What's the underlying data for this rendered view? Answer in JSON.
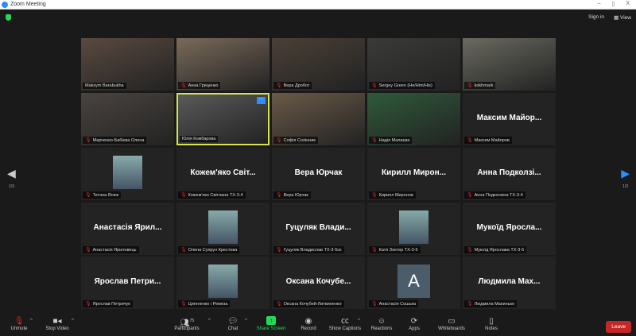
{
  "window": {
    "title": "Zoom Meeting",
    "minimize": "–",
    "restore": "▯",
    "close": "X"
  },
  "topbar": {
    "sign_in": "Sign in",
    "view": "View"
  },
  "page": {
    "left": "1/3",
    "right": "1/3"
  },
  "tiles": [
    {
      "label": "Maksym Barabukha",
      "type": "video",
      "muted": false
    },
    {
      "label": "Анна Гриценко",
      "type": "video",
      "muted": true
    },
    {
      "label": "Вера Дробот",
      "type": "video",
      "muted": true
    },
    {
      "label": "Sergey Green (He/Him/His)",
      "type": "video",
      "muted": true
    },
    {
      "label": "kokhmark",
      "type": "video",
      "muted": true
    },
    {
      "label": "Марченко-Бабієва Олена",
      "type": "video",
      "muted": true
    },
    {
      "label": "Юлія Комбарова",
      "type": "video",
      "muted": false,
      "active": true
    },
    {
      "label": "Софія Солінник",
      "type": "video",
      "muted": true
    },
    {
      "label": "Надія Малиєва",
      "type": "video",
      "muted": true
    },
    {
      "label": "Максим Майоров",
      "big": "Максим  Майор...",
      "type": "name",
      "muted": true
    },
    {
      "label": "Тетяна Янюк",
      "type": "pic",
      "muted": true
    },
    {
      "label": "Кожем'яко Світлана ТХ-3-4",
      "big": "Кожем'яко Світ...",
      "type": "name",
      "muted": true
    },
    {
      "label": "Вера Юрчак",
      "big": "Вера Юрчак",
      "type": "name",
      "muted": true
    },
    {
      "label": "Кирилл Миронов",
      "big": "Кирилл  Мирон...",
      "type": "name",
      "muted": true
    },
    {
      "label": "Анна Подколзіна ТХ-3-4",
      "big": "Анна Подколзі...",
      "type": "name",
      "muted": true
    },
    {
      "label": "Анастасія Яриловець",
      "big": "Анастасія Ярил...",
      "type": "name",
      "muted": true
    },
    {
      "label": "Олена Супрун Крестова",
      "type": "pic",
      "muted": true
    },
    {
      "label": "Гуцуляк Владислав ТХ-3-5ск",
      "big": "Гуцуляк  Влади...",
      "type": "name",
      "muted": true
    },
    {
      "label": "Катя Зоктер ТХ-3-5",
      "type": "pic",
      "muted": true
    },
    {
      "label": "Мукоїд Ярослава ТХ-3-5",
      "big": "Мукоїд  Яросла...",
      "type": "name",
      "muted": true
    },
    {
      "label": "Ярослав Петричук",
      "big": "Ярослав  Петри...",
      "type": "name",
      "muted": true
    },
    {
      "label": "Цигененко і Ремеза",
      "type": "pic",
      "muted": true
    },
    {
      "label": "Оксана Кочубей-Литвиненко",
      "big": "Оксана  Кочубе...",
      "type": "name",
      "muted": true
    },
    {
      "label": "Анастасія Сошька",
      "type": "avatar",
      "initial": "A",
      "muted": true
    },
    {
      "label": "Людмила Махинько",
      "big": "Людмила  Мах...",
      "type": "name",
      "muted": true
    }
  ],
  "toolbar": {
    "unmute": "Unmute",
    "stop_video": "Stop Video",
    "participants": "Participants",
    "participants_count": "75",
    "chat": "Chat",
    "share": "Share Screen",
    "record": "Record",
    "captions": "Show Captions",
    "reactions": "Reactions",
    "apps": "Apps",
    "whiteboards": "Whiteboards",
    "notes": "Notes",
    "leave": "Leave"
  },
  "colors": {
    "accent": "#2d8cff",
    "share": "#23d959",
    "leave": "#c62828",
    "active_border": "#d6e34a"
  }
}
